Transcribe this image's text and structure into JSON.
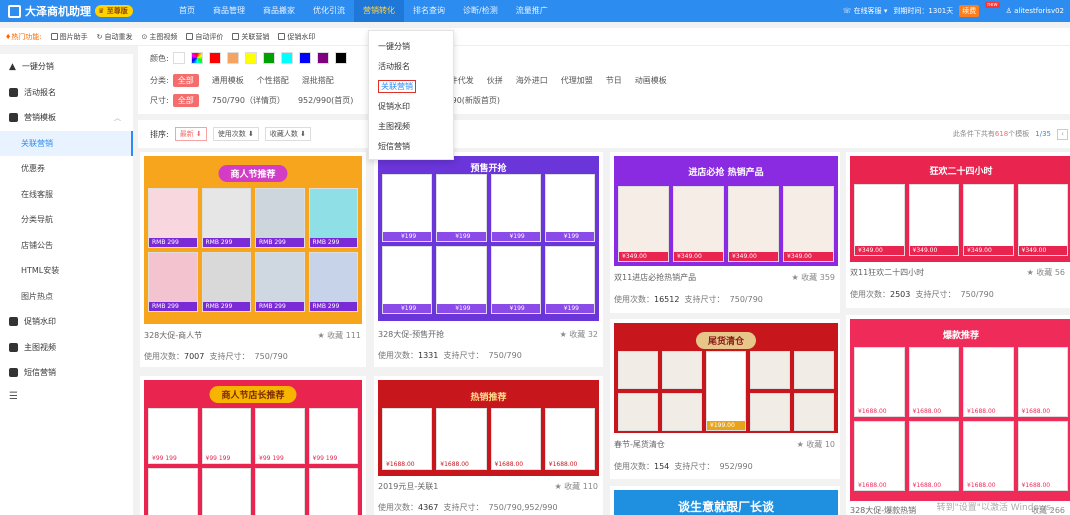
{
  "header": {
    "app_name": "大泽商机助理",
    "vip_badge": "至尊版",
    "nav": [
      {
        "label": "首页"
      },
      {
        "label": "商品管理"
      },
      {
        "label": "商品搬家"
      },
      {
        "label": "优化引流"
      },
      {
        "label": "营销转化",
        "active": true
      },
      {
        "label": "排名查询"
      },
      {
        "label": "诊断/检测"
      },
      {
        "label": "流量推广"
      }
    ],
    "support": "在线客服",
    "expiry": "到期时间：1301天",
    "renew": "续费",
    "new_tag": "new",
    "user": "alitestforisv02"
  },
  "hotbar": {
    "label": "热门功能:",
    "items": [
      "图片助手",
      "自动重发",
      "主图视频",
      "自动评价",
      "关联营销",
      "促销水印"
    ]
  },
  "sidebar": {
    "items": [
      {
        "label": "一键分销",
        "icon": "warning-icon"
      },
      {
        "label": "活动报名",
        "icon": "calendar-icon"
      },
      {
        "label": "营销模板",
        "icon": "template-icon",
        "expanded": true
      },
      {
        "label": "关联营销",
        "sub": true,
        "active": true
      },
      {
        "label": "优惠券",
        "sub": true
      },
      {
        "label": "在线客服",
        "sub": true
      },
      {
        "label": "分类导航",
        "sub": true
      },
      {
        "label": "店铺公告",
        "sub": true
      },
      {
        "label": "HTML安装",
        "sub": true
      },
      {
        "label": "图片热点",
        "sub": true
      },
      {
        "label": "促销水印",
        "icon": "watermark-icon"
      },
      {
        "label": "主图视频",
        "icon": "video-icon"
      },
      {
        "label": "短信营销",
        "icon": "sms-icon"
      }
    ],
    "toggle": "☰"
  },
  "filters": {
    "color_label": "颜色:",
    "colors": [
      "#ffffff",
      "rainbow",
      "#ff0000",
      "#f4a460",
      "#ffff00",
      "#00a000",
      "#00ffff",
      "#0000ff",
      "#800080",
      "#000000"
    ],
    "category_label": "分类:",
    "categories": [
      "全部",
      "通用模板",
      "个性搭配",
      "混批搭配",
      "",
      "一件代发",
      "伙拼",
      "海外进口",
      "代理加盟",
      "节日",
      "动画模板"
    ],
    "size_label": "尺寸:",
    "sizes": [
      "全部",
      "750/790（详情页）",
      "952/990(首页)",
      "",
      "1190(新版首页)"
    ]
  },
  "sortbar": {
    "label": "排序:",
    "options": [
      {
        "label": "最新 ⬇",
        "active": true
      },
      {
        "label": "使用次数 ⬇"
      },
      {
        "label": "收藏人数 ⬇"
      }
    ],
    "summary_prefix": "此条件下共有",
    "summary_count": "618",
    "summary_suffix": "个模板",
    "page": "1/35"
  },
  "dropdown": {
    "items": [
      "一键分销",
      "活动报名",
      "关联营销",
      "促销水印",
      "主图视频",
      "短信营销"
    ],
    "highlighted": 2
  },
  "cards": [
    {
      "banner": "商人节推荐",
      "title": "328大促-商人节",
      "fav": "★ 收藏 111",
      "uses_label": "使用次数：",
      "uses": "7007",
      "size_label": "支持尺寸：",
      "size": "750/790",
      "price_tag": "RMB 299"
    },
    {
      "banner": "预售开抢",
      "title": "328大促-预售开抢",
      "fav": "★ 收藏 32",
      "uses_label": "使用次数：",
      "uses": "1331",
      "size_label": "支持尺寸：",
      "size": "750/790",
      "price_tag": "¥199"
    },
    {
      "banner": "进店必抢 热销产品",
      "title": "双11进店必抢热销产品",
      "fav": "★ 收藏 359",
      "uses_label": "使用次数：",
      "uses": "16512",
      "size_label": "支持尺寸：",
      "size": "750/790",
      "price_tag": "¥349.00"
    },
    {
      "banner": "狂欢二十四小时",
      "title": "双11狂欢二十四小时",
      "fav": "★ 收藏 56",
      "uses_label": "使用次数：",
      "uses": "2503",
      "size_label": "支持尺寸：",
      "size": "750/790",
      "price_tag": "¥349.00"
    },
    {
      "banner": "尾货清仓",
      "title": "春节-尾货清仓",
      "fav": "★ 收藏 10",
      "uses_label": "使用次数：",
      "uses": "154",
      "size_label": "支持尺寸：",
      "size": "952/990",
      "price_tag": "¥199.00"
    },
    {
      "banner": "热销推荐",
      "title": "2019元旦-关联1",
      "fav": "★ 收藏 110",
      "uses_label": "使用次数：",
      "uses": "4367",
      "size_label": "支持尺寸：",
      "size": "750/790,952/990",
      "price_tag": "¥1688.00"
    },
    {
      "banner": "商人节店长推荐",
      "title": "",
      "price_tag": "¥99 199"
    },
    {
      "banner": "爆款推荐",
      "title": "328大促-爆款热销",
      "fav": "收藏 266",
      "price_tag": "¥1688.00"
    },
    {
      "banner": "谈生意就跟厂长谈",
      "title": ""
    }
  ],
  "watermark": "转到\"设置\"以激活 Windows。"
}
